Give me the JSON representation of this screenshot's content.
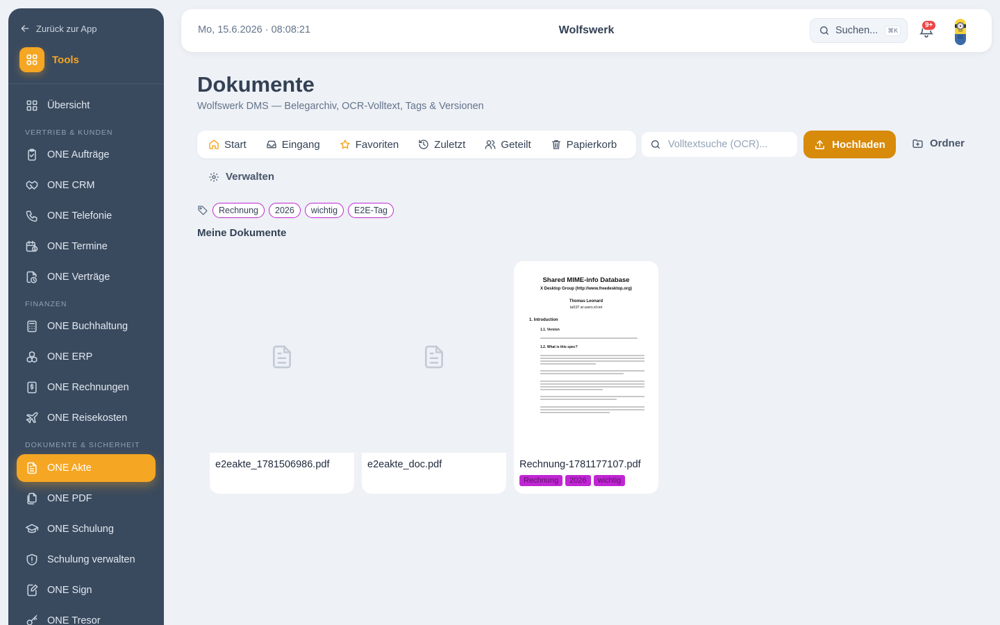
{
  "sidebar": {
    "back_label": "Zurück zur App",
    "tools_label": "Tools",
    "overview_label": "Übersicht",
    "sections": {
      "sales": "VERTRIEB & KUNDEN",
      "finance": "FINANZEN",
      "docs": "DOKUMENTE & SICHERHEIT"
    },
    "items": {
      "auftraege": "ONE Aufträge",
      "crm": "ONE CRM",
      "telefonie": "ONE Telefonie",
      "termine": "ONE Termine",
      "vertraege": "ONE Verträge",
      "buchhaltung": "ONE Buchhaltung",
      "erp": "ONE ERP",
      "rechnungen": "ONE Rechnungen",
      "reisekosten": "ONE Reisekosten",
      "akte": "ONE Akte",
      "pdf": "ONE PDF",
      "schulung": "ONE Schulung",
      "schulung_verwalten": "Schulung verwalten",
      "sign": "ONE Sign",
      "tresor": "ONE Tresor"
    },
    "active_color": "#f5a623"
  },
  "header": {
    "datetime": "Mo, 15.6.2026 · 08:08:21",
    "title": "Wolfswerk",
    "search_label": "Suchen...",
    "search_shortcut": "⌘K",
    "notifications_badge": "9+"
  },
  "page": {
    "title": "Dokumente",
    "subtitle": "Wolfswerk DMS — Belegarchiv, OCR-Volltext, Tags & Versionen"
  },
  "toolbar": {
    "tabs": {
      "start": "Start",
      "eingang": "Eingang",
      "favoriten": "Favoriten",
      "zuletzt": "Zuletzt",
      "geteilt": "Geteilt",
      "papierkorb": "Papierkorb"
    },
    "search_placeholder": "Volltextsuche (OCR)...",
    "upload_label": "Hochladen",
    "folder_label": "Ordner",
    "manage_label": "Verwalten",
    "upload_color": "#d88a0a"
  },
  "tags": [
    "Rechnung",
    "2026",
    "wichtig",
    "E2E-Tag"
  ],
  "section_title": "Meine Dokumente",
  "documents": [
    {
      "name": "e2eakte_1781506986.pdf",
      "preview": "file-icon"
    },
    {
      "name": "e2eakte_doc.pdf",
      "preview": "file-icon"
    },
    {
      "name": "Rechnung-1781177107.pdf",
      "preview": "pdf-thumbnail",
      "tags": [
        "Rechnung",
        "2026",
        "wichtig"
      ],
      "thumbnail": {
        "title": "Shared MIME-info Database",
        "line1": "X Desktop Group  (http://www.freedesktop.org)",
        "author": "Thomas Leonard",
        "email": "tal197 at users.sf.net",
        "h1": "1. Introduction",
        "h2": "1.1. Version",
        "h3": "1.2. What is this spec?"
      }
    }
  ]
}
